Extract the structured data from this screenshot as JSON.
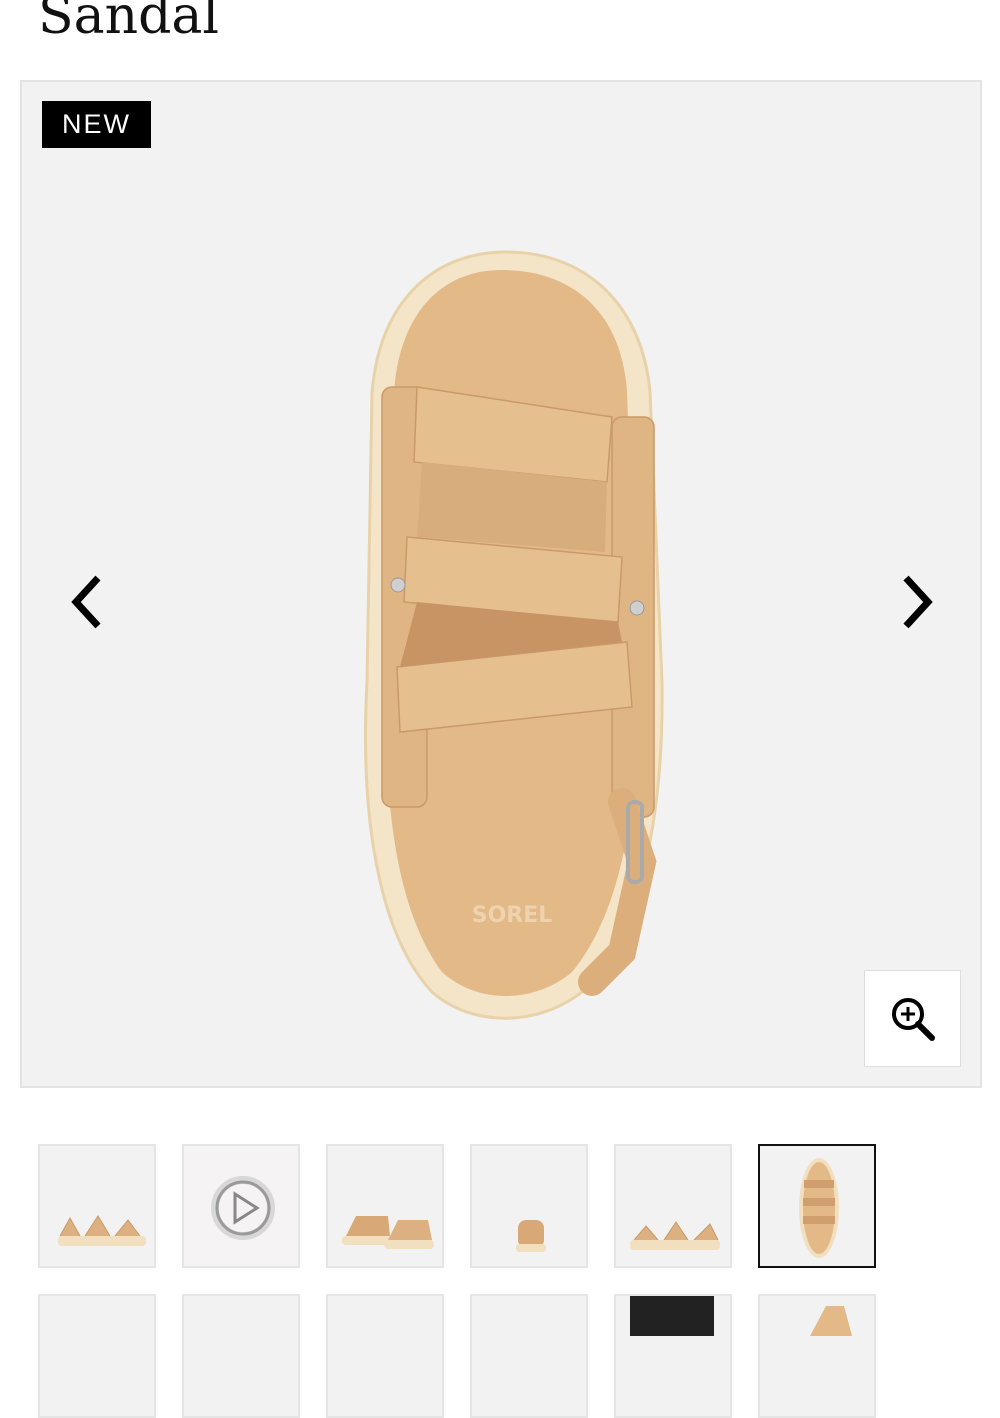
{
  "product": {
    "title_fragment": "Sandal"
  },
  "gallery": {
    "badge": "NEW",
    "main_image": "sandal-top-view",
    "prev_icon": "chevron-left-icon",
    "next_icon": "chevron-right-icon",
    "zoom_icon": "zoom-in-icon",
    "selected_index": 5
  },
  "thumbnails": [
    {
      "image": "sandal-side-view"
    },
    {
      "image": "product-video",
      "icon": "play-icon"
    },
    {
      "image": "sandal-pair-view"
    },
    {
      "image": "sandal-back-view"
    },
    {
      "image": "sandal-side-view-alt"
    },
    {
      "image": "sandal-top-view"
    }
  ],
  "thumbnails_row2": [
    {
      "image": "partial-thumb-1"
    },
    {
      "image": "partial-thumb-2"
    },
    {
      "image": "partial-thumb-3"
    },
    {
      "image": "partial-thumb-4"
    },
    {
      "image": "lifestyle-thumb"
    },
    {
      "image": "sandal-detail-thumb"
    }
  ],
  "colors": {
    "badge_bg": "#000000",
    "gallery_bg": "#f2f2f2",
    "sandal": "#e2b987",
    "sole": "#f3e3c6"
  }
}
